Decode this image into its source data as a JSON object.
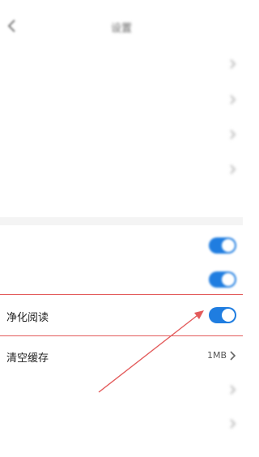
{
  "status_bar": {
    "left": "",
    "right": ""
  },
  "header": {
    "title": "设置"
  },
  "rows": [
    {
      "label": "",
      "value": ""
    },
    {
      "label": "",
      "value": ""
    },
    {
      "label": "",
      "value": ""
    },
    {
      "label": "",
      "value": ""
    },
    {
      "label": ""
    },
    {
      "label": "",
      "toggle_on": true
    },
    {
      "label": "",
      "toggle_on": true
    },
    {
      "label": "净化阅读",
      "toggle_on": true
    },
    {
      "label": "清空缓存",
      "value": "1MB"
    },
    {
      "label": ""
    },
    {
      "label": "",
      "value": ""
    }
  ],
  "colors": {
    "accent": "#1f7de0",
    "annotation": "#e35b5b"
  }
}
